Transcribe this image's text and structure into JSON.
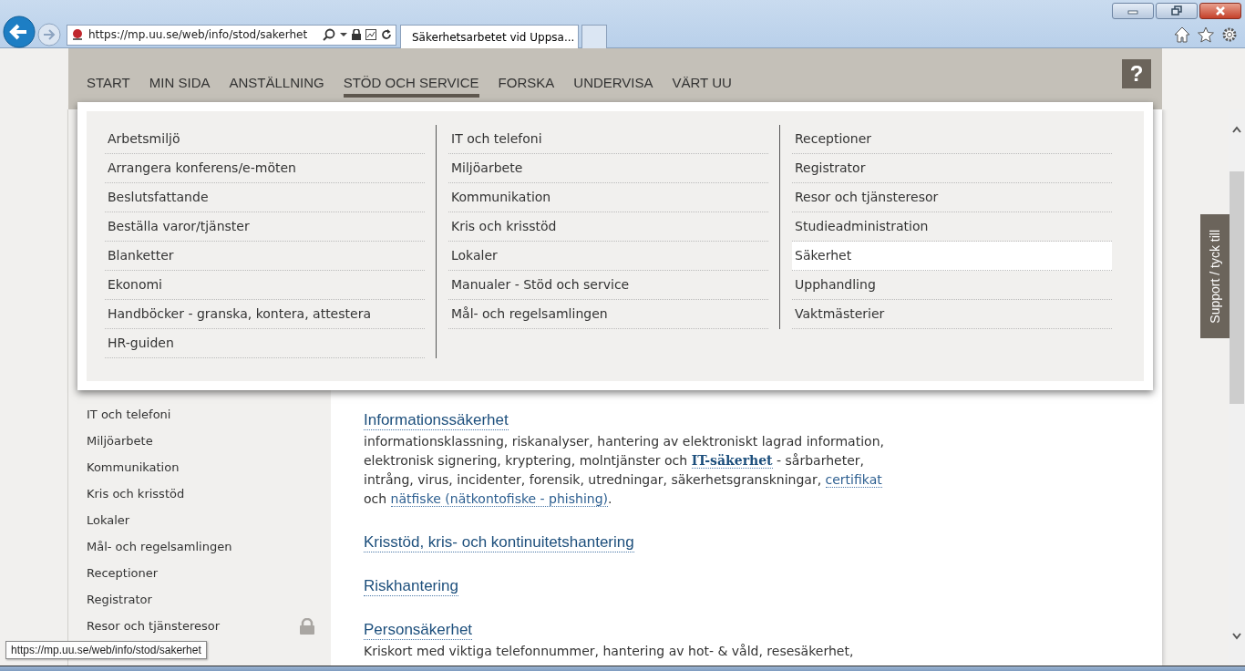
{
  "browser": {
    "address": "https://mp.uu.se/web/info/stod/sakerhet",
    "tabs": [
      {
        "title": "Säkerhetsarbetet vid Uppsa...",
        "selected": true
      }
    ]
  },
  "nav": {
    "items": [
      {
        "label": "START",
        "selected": false
      },
      {
        "label": "MIN SIDA",
        "selected": false
      },
      {
        "label": "ANSTÄLLNING",
        "selected": false
      },
      {
        "label": "STÖD OCH SERVICE",
        "selected": true
      },
      {
        "label": "FORSKA",
        "selected": false
      },
      {
        "label": "UNDERVISA",
        "selected": false
      },
      {
        "label": "VÄRT UU",
        "selected": false
      }
    ],
    "help": "?"
  },
  "mega_menu": {
    "columns": [
      [
        {
          "label": "Arbetsmiljö",
          "selected": false
        },
        {
          "label": "Arrangera konferens/e-möten",
          "selected": false
        },
        {
          "label": "Beslutsfattande",
          "selected": false
        },
        {
          "label": "Beställa varor/tjänster",
          "selected": false
        },
        {
          "label": "Blanketter",
          "selected": false
        },
        {
          "label": "Ekonomi",
          "selected": false
        },
        {
          "label": "Handböcker - granska, kontera, attestera",
          "selected": false
        },
        {
          "label": "HR-guiden",
          "selected": false
        }
      ],
      [
        {
          "label": "IT och telefoni",
          "selected": false
        },
        {
          "label": "Miljöarbete",
          "selected": false
        },
        {
          "label": "Kommunikation",
          "selected": false
        },
        {
          "label": "Kris och krisstöd",
          "selected": false
        },
        {
          "label": "Lokaler",
          "selected": false
        },
        {
          "label": "Manualer - Stöd och service",
          "selected": false
        },
        {
          "label": "Mål- och regelsamlingen",
          "selected": false
        }
      ],
      [
        {
          "label": "Receptioner",
          "selected": false
        },
        {
          "label": "Registrator",
          "selected": false
        },
        {
          "label": "Resor och tjänsteresor",
          "selected": false
        },
        {
          "label": "Studieadministration",
          "selected": false
        },
        {
          "label": "Säkerhet",
          "selected": true
        },
        {
          "label": "Upphandling",
          "selected": false
        },
        {
          "label": "Vaktmästerier",
          "selected": false
        }
      ]
    ]
  },
  "sidebar": {
    "items": [
      {
        "label": "IT och telefoni",
        "locked": false
      },
      {
        "label": "Miljöarbete",
        "locked": false
      },
      {
        "label": "Kommunikation",
        "locked": false
      },
      {
        "label": "Kris och krisstöd",
        "locked": false
      },
      {
        "label": "Lokaler",
        "locked": false
      },
      {
        "label": "Mål- och regelsamlingen",
        "locked": false
      },
      {
        "label": "Receptioner",
        "locked": false
      },
      {
        "label": "Registrator",
        "locked": false
      },
      {
        "label": "Resor och tjänsteresor",
        "locked": true
      }
    ]
  },
  "content": {
    "sections": [
      {
        "heading": "Informationssäkerhet",
        "text": [
          {
            "kind": "text",
            "text": "informationsklassning, riskanalyser, hantering av elektroniskt lagrad information, elektronisk signering, kryptering, molntjänster och "
          },
          {
            "kind": "strong_link",
            "text": "IT-säkerhet"
          },
          {
            "kind": "text",
            "text": " - sårbarheter, intrång, virus, incidenter, forensik, utredningar, säkerhetsgranskningar, "
          },
          {
            "kind": "link",
            "text": "certifikat"
          },
          {
            "kind": "text",
            "text": " och "
          },
          {
            "kind": "link",
            "text": "nätfiske (nätkontofiske - phishing)"
          },
          {
            "kind": "text",
            "text": "."
          }
        ]
      },
      {
        "heading": "Krisstöd, kris- och kontinuitetshantering"
      },
      {
        "heading": "Riskhantering"
      },
      {
        "heading": "Personsäkerhet",
        "text": [
          {
            "kind": "text",
            "text": "Kriskort med viktiga telefonnummer, hantering av hot- & våld, resesäkerhet,"
          }
        ]
      }
    ]
  },
  "support_tab": "Support / tyck till",
  "status_tooltip": "https://mp.uu.se/web/info/stod/sakerhet"
}
